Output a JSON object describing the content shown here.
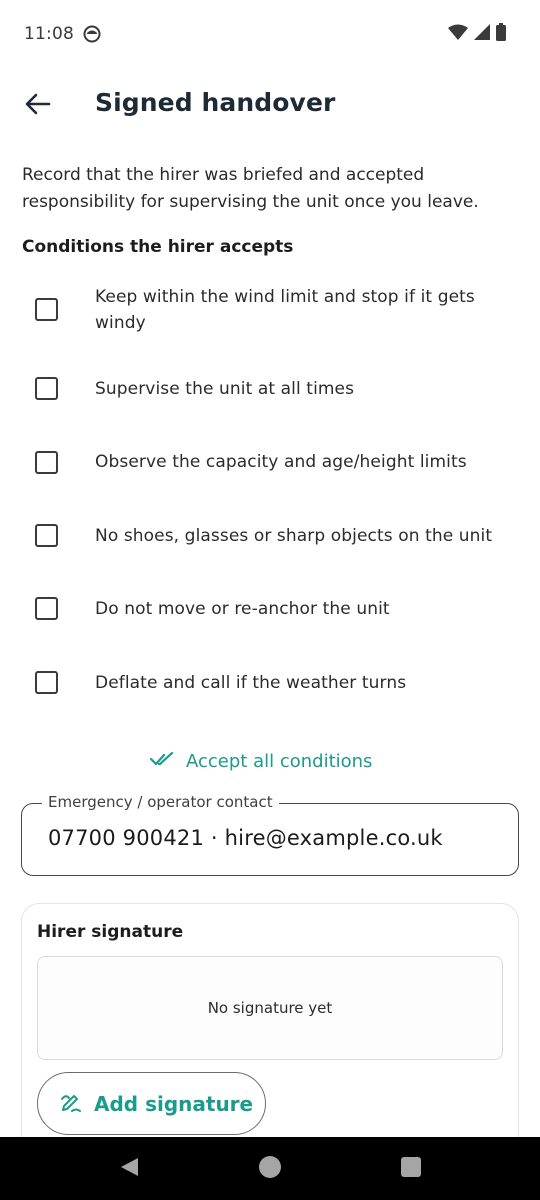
{
  "status_bar": {
    "time": "11:08",
    "icons": [
      "notification-face-icon",
      "wifi-icon",
      "cellular-signal-icon",
      "battery-icon"
    ]
  },
  "app_bar": {
    "title": "Signed handover",
    "back_icon": "arrow-left-icon"
  },
  "intro_text": "Record that the hirer was briefed and accepted responsibility for supervising the unit once you leave.",
  "conditions": {
    "heading": "Conditions the hirer accepts",
    "items": [
      {
        "label": "Keep within the wind limit and stop if it gets windy",
        "checked": false
      },
      {
        "label": "Supervise the unit at all times",
        "checked": false
      },
      {
        "label": "Observe the capacity and age/height limits",
        "checked": false
      },
      {
        "label": "No shoes, glasses or sharp objects on the unit",
        "checked": false
      },
      {
        "label": "Do not move or re-anchor the unit",
        "checked": false
      },
      {
        "label": "Deflate and call if the weather turns",
        "checked": false
      }
    ],
    "accept_all_label": "Accept all conditions"
  },
  "contact": {
    "label": "Emergency / operator contact",
    "value": "07700 900421 · hire@example.co.uk"
  },
  "signature": {
    "title": "Hirer signature",
    "placeholder": "No signature yet",
    "button_label": "Add signature"
  },
  "colors": {
    "accent": "#1a9b8c",
    "title": "#1f2a37",
    "nav_bar": "#000000"
  }
}
